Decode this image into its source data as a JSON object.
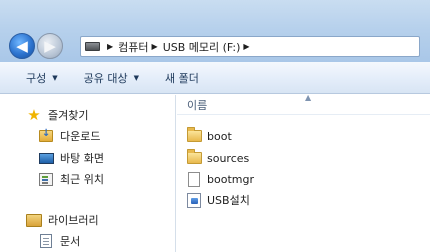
{
  "titlebar": {
    "breadcrumb": [
      "컴퓨터",
      "USB 메모리 (F:)"
    ]
  },
  "toolbar": {
    "organize_label": "구성",
    "share_label": "공유 대상",
    "new_folder_label": "새 폴더"
  },
  "nav_pane": {
    "favorites": {
      "label": "즐겨찾기",
      "icon": "star-icon"
    },
    "items": [
      {
        "label": "다운로드",
        "icon": "downloads-folder-icon"
      },
      {
        "label": "바탕 화면",
        "icon": "desktop-icon"
      },
      {
        "label": "최근 위치",
        "icon": "recent-places-icon"
      }
    ],
    "libraries": {
      "label": "라이브러리",
      "icon": "libraries-icon"
    },
    "library_items": [
      {
        "label": "문서",
        "icon": "documents-icon"
      }
    ]
  },
  "content": {
    "column_header": "이름",
    "files": [
      {
        "name": "boot",
        "icon": "folder-icon"
      },
      {
        "name": "sources",
        "icon": "folder-icon"
      },
      {
        "name": "bootmgr",
        "icon": "file-icon"
      },
      {
        "name": "USB설치",
        "icon": "setup-icon"
      }
    ]
  }
}
